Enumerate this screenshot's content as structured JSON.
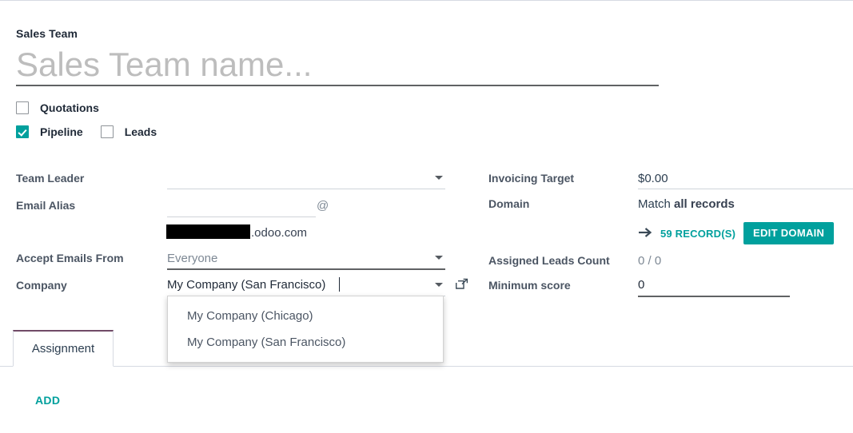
{
  "record": {
    "model_label": "Sales Team",
    "name_placeholder": "Sales Team name..."
  },
  "options": [
    {
      "label": "Quotations",
      "checked": false,
      "name": "quotations"
    },
    {
      "label": "Pipeline",
      "checked": true,
      "name": "pipeline"
    },
    {
      "label": "Leads",
      "checked": false,
      "name": "leads"
    }
  ],
  "left_fields": {
    "team_leader": {
      "label": "Team Leader",
      "value": ""
    },
    "email_alias": {
      "label": "Email Alias",
      "value": "",
      "at": "@",
      "domain_suffix": ".odoo.com"
    },
    "accept_emails_from": {
      "label": "Accept Emails From",
      "value": "Everyone"
    },
    "company": {
      "label": "Company",
      "value": "My Company (San Francisco)"
    }
  },
  "right_fields": {
    "invoicing_target": {
      "label": "Invoicing Target",
      "value": "$0.00"
    },
    "domain": {
      "label": "Domain",
      "match_prefix": "Match ",
      "match_strong": "all records"
    },
    "records_link": "59 RECORD(S)",
    "edit_domain_button": "EDIT DOMAIN",
    "assigned_leads_count": {
      "label": "Assigned Leads Count",
      "value": "0 / 0"
    },
    "minimum_score": {
      "label": "Minimum score",
      "value": "0"
    }
  },
  "company_dropdown": {
    "open": true,
    "items": [
      "My Company (Chicago)",
      "My Company (San Francisco)"
    ]
  },
  "notebook": {
    "tabs": [
      {
        "label": "Assignment",
        "active": true
      }
    ],
    "add_label": "ADD"
  },
  "colors": {
    "accent_teal": "#00A09D",
    "brand_purple": "#714B67",
    "text_dark": "#2c3e50",
    "label_gray": "#4b5563",
    "border_light": "#d6dae2"
  },
  "icons": {
    "dropdown_caret": "chevron-down-icon",
    "external_link": "external-link-icon",
    "arrow_right": "arrow-right-icon"
  }
}
